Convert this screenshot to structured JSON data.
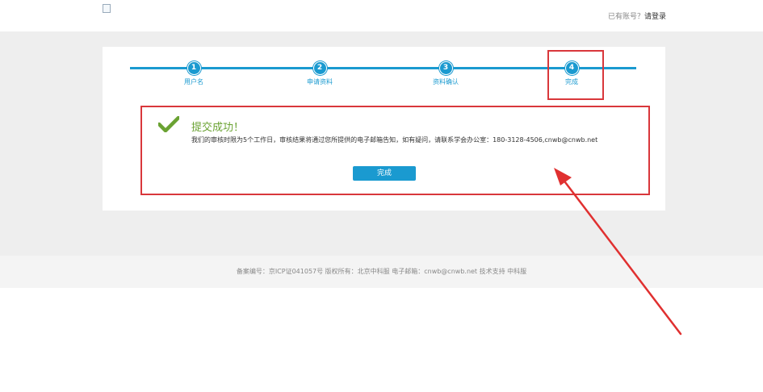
{
  "header": {
    "login_prompt": "已有账号？",
    "login_link": "请登录"
  },
  "steps": [
    {
      "number": "1",
      "label": "用户名"
    },
    {
      "number": "2",
      "label": "申请资料"
    },
    {
      "number": "3",
      "label": "资料确认"
    },
    {
      "number": "4",
      "label": "完成"
    }
  ],
  "result": {
    "title": "提交成功！",
    "message": "我们的审核时限为5个工作日，审核结果将通过您所提供的电子邮箱告知，如有疑问，请联系学会办公室：180-3128-4506,cnwb@cnwb.net",
    "button_label": "完成"
  },
  "footer": {
    "text": "备案编号：京ICP证041057号 版权所有：北京中科服 电子邮箱：cnwb@cnwb.net 技术支持 中科服"
  },
  "colors": {
    "accent": "#1a9ad0",
    "success": "#6aa232",
    "annotation": "#d9373b"
  }
}
